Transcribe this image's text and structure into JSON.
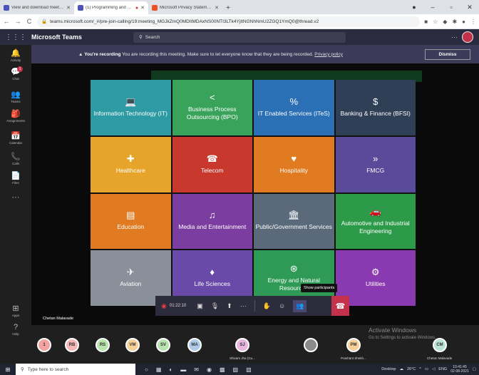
{
  "browser": {
    "tabs": [
      {
        "label": "View and download meeting atte...",
        "color": "#4b53bc",
        "active": false
      },
      {
        "label": "(1) Programming and Proble...",
        "color": "#4b53bc",
        "active": true
      },
      {
        "label": "Microsoft Privacy Statement – Mi...",
        "color": "#f25022",
        "active": false
      }
    ],
    "new_tab": "+",
    "url": "teams.microsoft.com/_#/pre-join-calling/19:meeting_MGJkZmQ0MDItMDAxNS00NTI3LTk4YjItNGNhNmU2ZGQ1YmQ0@thread.v2"
  },
  "teams": {
    "brand": "Microsoft Teams",
    "search_placeholder": "Search",
    "more": "···"
  },
  "rail": [
    {
      "label": "Activity",
      "icon": "bell-icon",
      "glyph": "🔔"
    },
    {
      "label": "Chat",
      "icon": "chat-icon",
      "glyph": "💬",
      "badge": "1"
    },
    {
      "label": "Teams",
      "icon": "teams-icon",
      "glyph": "👥"
    },
    {
      "label": "Assignments",
      "icon": "assignments-icon",
      "glyph": "🎒"
    },
    {
      "label": "Calendar",
      "icon": "calendar-icon",
      "glyph": "📅"
    },
    {
      "label": "Calls",
      "icon": "phone-icon",
      "glyph": "📞"
    },
    {
      "label": "Files",
      "icon": "file-icon",
      "glyph": "📄"
    },
    {
      "label": "",
      "icon": "more-icon",
      "glyph": "···"
    },
    {
      "label": "Apps",
      "icon": "apps-icon",
      "glyph": "⊞"
    },
    {
      "label": "Help",
      "icon": "help-icon",
      "glyph": "?"
    }
  ],
  "banner": {
    "bold": "You're recording",
    "text": " You are recording this meeting. Make sure to let everyone know that they are being recorded.",
    "link": "Privacy policy",
    "dismiss": "Dismiss"
  },
  "slide": {
    "tiles": [
      {
        "label": "Information Technology (IT)",
        "color": "#2e9aa3",
        "glyph": "💻",
        "icon": "laptop-icon"
      },
      {
        "label": "Business Process Outsourcing (BPO)",
        "color": "#3aa35b",
        "glyph": "<",
        "icon": "share-icon"
      },
      {
        "label": "IT Enabled Services (ITeS)",
        "color": "#2b6fb5",
        "glyph": "%",
        "icon": "link-icon"
      },
      {
        "label": "Banking & Finance (BFSI)",
        "color": "#2f3f55",
        "glyph": "$",
        "icon": "dollar-icon"
      },
      {
        "label": "Healthcare",
        "color": "#e6a52a",
        "glyph": "✚",
        "icon": "medkit-icon"
      },
      {
        "label": "Telecom",
        "color": "#c8382d",
        "glyph": "☎",
        "icon": "telephone-icon"
      },
      {
        "label": "Hospitality",
        "color": "#e07b22",
        "glyph": "♥",
        "icon": "heart-icon"
      },
      {
        "label": "FMCG",
        "color": "#5a4a9a",
        "glyph": "»",
        "icon": "chevrons-icon"
      },
      {
        "label": "Education",
        "color": "#e07b22",
        "glyph": "▤",
        "icon": "book-icon"
      },
      {
        "label": "Media and Entertainment",
        "color": "#7b3da0",
        "glyph": "♫",
        "icon": "music-icon"
      },
      {
        "label": "Public/Government Services",
        "color": "#5a6a7a",
        "glyph": "🏛",
        "icon": "building-icon"
      },
      {
        "label": "Automotive and Industrial Engineering",
        "color": "#2d9a4a",
        "glyph": "🚗",
        "icon": "car-icon"
      },
      {
        "label": "Aviation",
        "color": "#8a9099",
        "glyph": "✈",
        "icon": "plane-icon"
      },
      {
        "label": "Life Sciences",
        "color": "#6a4aa8",
        "glyph": "♦",
        "icon": "figure-icon"
      },
      {
        "label": "Energy and Natural Resources",
        "color": "#2e9a55",
        "glyph": "⊛",
        "icon": "globe-icon"
      },
      {
        "label": "Utilities",
        "color": "#8a3ab0",
        "glyph": "⚙",
        "icon": "gears-icon"
      }
    ],
    "presenter": "Chetan Malavade"
  },
  "controls": {
    "timer": "01:22:10",
    "tooltip": "Show participants"
  },
  "participants": [
    {
      "initials": "1",
      "color": "#f4a3a3",
      "name": ""
    },
    {
      "initials": "RB",
      "color": "#f7b7b7",
      "name": ""
    },
    {
      "initials": "RS",
      "color": "#b9e3b0",
      "name": ""
    },
    {
      "initials": "VM",
      "color": "#f7d09a",
      "name": ""
    },
    {
      "initials": "SV",
      "color": "#b9e3b0",
      "name": ""
    },
    {
      "initials": "MA",
      "color": "#aecbe8",
      "name": ""
    },
    {
      "initials": "SJ",
      "color": "#e9b6e0",
      "name": "Shivam Jha (Gu..."
    },
    {
      "initials": "",
      "color": "#8a8a8a",
      "name": ""
    },
    {
      "initials": "PM",
      "color": "#f7d09a",
      "name": "Prashant Shekh..."
    },
    {
      "initials": "CM",
      "color": "#b9e3d6",
      "name": "Chetan Malavade"
    }
  ],
  "watermark": {
    "title": "Activate Windows",
    "sub": "Go to Settings to activate Windows."
  },
  "taskbar": {
    "search_placeholder": "Type here to search",
    "desktop": "Desktop",
    "weather": "26°C",
    "lang": "ENG",
    "time": "10:41:45",
    "date": "02-08-2021"
  }
}
